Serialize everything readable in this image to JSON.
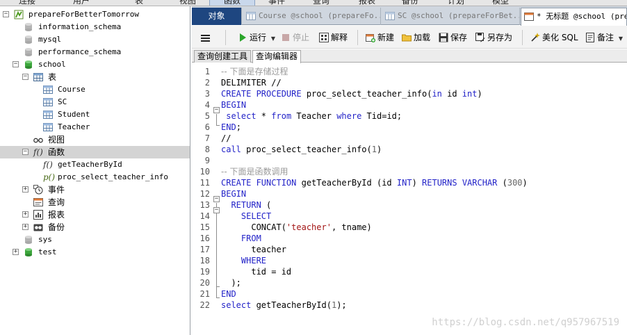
{
  "top_menu": {
    "items": [
      {
        "label": "连接"
      },
      {
        "label": "用户"
      },
      {
        "label": "表"
      },
      {
        "label": "视图"
      },
      {
        "label": "函数"
      },
      {
        "label": "事件"
      },
      {
        "label": "查询"
      },
      {
        "label": "报表"
      },
      {
        "label": "备份"
      },
      {
        "label": "计划"
      },
      {
        "label": "模型"
      }
    ]
  },
  "tree": {
    "connection": "prepareForBetterTomorrow",
    "databases": {
      "information_schema": "information_schema",
      "mysql": "mysql",
      "performance_schema": "performance_schema",
      "school": "school",
      "sys": "sys",
      "test": "test"
    },
    "school_children": {
      "tables_label": "表",
      "tables": [
        "Course",
        "SC",
        "Student",
        "Teacher"
      ],
      "views_label": "视图",
      "functions_label": "函数",
      "functions": [
        "getTeacherById",
        "proc_select_teacher_info"
      ],
      "events_label": "事件",
      "queries_label": "查询",
      "reports_label": "报表",
      "backups_label": "备份"
    }
  },
  "tabs": {
    "objects": "对象",
    "tab1": "Course @school (prepareFo...",
    "tab2": "SC @school (prepareForBet...",
    "tab3": "* 无标题 @school (prep"
  },
  "toolbar": {
    "menu_icon": "hamburger-icon",
    "run": "运行",
    "stop": "停止",
    "explain": "解释",
    "new": "新建",
    "load": "加载",
    "save": "保存",
    "save_as": "另存为",
    "beautify": "美化 SQL",
    "notes": "备注"
  },
  "subtabs": {
    "query_builder": "查询创建工具",
    "query_editor": "查询编辑器"
  },
  "editor": {
    "line_numbers": [
      "1",
      "2",
      "3",
      "4",
      "5",
      "6",
      "7",
      "8",
      "9",
      "10",
      "11",
      "12",
      "13",
      "14",
      "15",
      "16",
      "17",
      "18",
      "19",
      "20",
      "21",
      "22"
    ],
    "lines": [
      [
        {
          "t": "-- 下面是存储过程",
          "c": "cm"
        }
      ],
      [
        {
          "t": "DELIMITER //",
          "c": "pl"
        }
      ],
      [
        {
          "t": "CREATE PROCEDURE",
          "c": "kw"
        },
        {
          "t": " proc_select_teacher_info(",
          "c": "pl"
        },
        {
          "t": "in",
          "c": "kw"
        },
        {
          "t": " id ",
          "c": "pl"
        },
        {
          "t": "int",
          "c": "kw"
        },
        {
          "t": ")",
          "c": "pl"
        }
      ],
      [
        {
          "t": "BEGIN",
          "c": "kw"
        }
      ],
      [
        {
          "t": " select",
          "c": "kw"
        },
        {
          "t": " * ",
          "c": "pl"
        },
        {
          "t": "from",
          "c": "kw"
        },
        {
          "t": " Teacher ",
          "c": "pl"
        },
        {
          "t": "where",
          "c": "kw"
        },
        {
          "t": " Tid=id;",
          "c": "pl"
        }
      ],
      [
        {
          "t": "END",
          "c": "kw"
        },
        {
          "t": ";",
          "c": "pl"
        }
      ],
      [
        {
          "t": "//",
          "c": "pl"
        }
      ],
      [
        {
          "t": "call",
          "c": "kw"
        },
        {
          "t": " proc_select_teacher_info(",
          "c": "pl"
        },
        {
          "t": "1",
          "c": "num"
        },
        {
          "t": ")",
          "c": "pl"
        }
      ],
      [],
      [
        {
          "t": "-- 下面是函数调用",
          "c": "cm"
        }
      ],
      [
        {
          "t": "CREATE FUNCTION",
          "c": "kw"
        },
        {
          "t": " getTeacherById (id ",
          "c": "pl"
        },
        {
          "t": "INT",
          "c": "kw"
        },
        {
          "t": ") ",
          "c": "pl"
        },
        {
          "t": "RETURNS VARCHAR",
          "c": "kw"
        },
        {
          "t": " (",
          "c": "pl"
        },
        {
          "t": "300",
          "c": "num"
        },
        {
          "t": ")",
          "c": "pl"
        }
      ],
      [
        {
          "t": "BEGIN",
          "c": "kw"
        }
      ],
      [
        {
          "t": "  RETURN",
          "c": "kw"
        },
        {
          "t": " (",
          "c": "pl"
        }
      ],
      [
        {
          "t": "    SELECT",
          "c": "kw"
        }
      ],
      [
        {
          "t": "      CONCAT(",
          "c": "pl"
        },
        {
          "t": "'teacher'",
          "c": "str"
        },
        {
          "t": ", tname)",
          "c": "pl"
        }
      ],
      [
        {
          "t": "    FROM",
          "c": "kw"
        }
      ],
      [
        {
          "t": "      teacher",
          "c": "pl"
        }
      ],
      [
        {
          "t": "    WHERE",
          "c": "kw"
        }
      ],
      [
        {
          "t": "      tid = id",
          "c": "pl"
        }
      ],
      [
        {
          "t": "  );",
          "c": "pl"
        }
      ],
      [
        {
          "t": "END",
          "c": "kw"
        }
      ],
      [
        {
          "t": "select",
          "c": "kw"
        },
        {
          "t": " getTeacherById(",
          "c": "pl"
        },
        {
          "t": "1",
          "c": "num"
        },
        {
          "t": ");",
          "c": "pl"
        }
      ]
    ]
  },
  "watermark": "https://blog.csdn.net/q957967519",
  "colors": {
    "objects_tab": "#1e4680",
    "keyword": "#2323c8",
    "comment": "#9a9a9a",
    "string": "#a31515",
    "selection": "#d4d4d4",
    "db_icon_active": "#3ca63c",
    "db_icon_inactive": "#b4b4b4"
  }
}
